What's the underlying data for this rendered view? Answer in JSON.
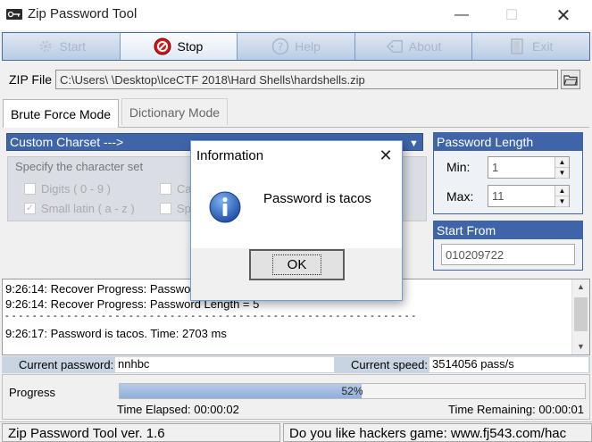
{
  "window": {
    "title": "Zip Password Tool",
    "controls": [
      "minimize",
      "maximize",
      "close"
    ]
  },
  "toolbar": {
    "buttons": [
      {
        "label": "Start",
        "icon": "gear-icon",
        "enabled": false
      },
      {
        "label": "Stop",
        "icon": "stop-icon",
        "enabled": true
      },
      {
        "label": "Help",
        "icon": "help-icon",
        "enabled": false
      },
      {
        "label": "About",
        "icon": "tag-icon",
        "enabled": false
      },
      {
        "label": "Exit",
        "icon": "exit-icon",
        "enabled": false
      }
    ]
  },
  "zip": {
    "label": "ZIP File",
    "path": "C:\\Users\\       \\Desktop\\IceCTF 2018\\Hard Shells\\hardshells.zip",
    "browse_icon": "folder-icon"
  },
  "tabs": {
    "brute": "Brute Force Mode",
    "dictionary": "Dictionary Mode",
    "active": "brute"
  },
  "charset": {
    "dropdown": "Custom Charset  --->",
    "group_title": "Specify the character set",
    "options": [
      {
        "label": "Digits ( 0 - 9 )",
        "checked": false
      },
      {
        "label": "Small latin ( a - z )",
        "checked": true
      },
      {
        "label": "Ca",
        "checked": false
      },
      {
        "label": "Sp",
        "checked": false
      }
    ]
  },
  "password_length": {
    "title": "Password Length",
    "min_label": "Min:",
    "min_value": "1",
    "max_label": "Max:",
    "max_value": "11"
  },
  "start_from": {
    "title": "Start From",
    "value": "010209722"
  },
  "log": {
    "lines": [
      "9:26:14: Recover Progress: Passwo",
      "9:26:14: Recover Progress: Password Length = 5",
      "- - - - - - - - - - - - - - - - - - - - - - - - - - - - - - - - - - - - - - - - - - - - - - - - - - - - - - - - - - - -",
      "9:26:17: Password is tacos. Time: 2703 ms"
    ]
  },
  "current": {
    "password_label": "Current password:",
    "password_value": "nnhbc",
    "speed_label": "Current speed:",
    "speed_value": "3514056 pass/s"
  },
  "progress": {
    "label": "Progress",
    "percent_text": "52%",
    "fraction": 0.52,
    "elapsed": "Time Elapsed: 00:00:02",
    "remaining": "Time Remaining: 00:00:01"
  },
  "statusbar": {
    "left": "Zip Password Tool ver. 1.6",
    "right": "Do you like hackers game: www.fj543.com/hac"
  },
  "dialog": {
    "title": "Information",
    "message": "Password is tacos",
    "ok_label": "OK",
    "icon": "info-icon"
  },
  "colors": {
    "accent_blue": "#3f65a8",
    "toolbar_gradient_top": "#dfe8f4",
    "toolbar_gradient_bottom": "#b9cce5",
    "progress_fill": "#8faedb"
  }
}
